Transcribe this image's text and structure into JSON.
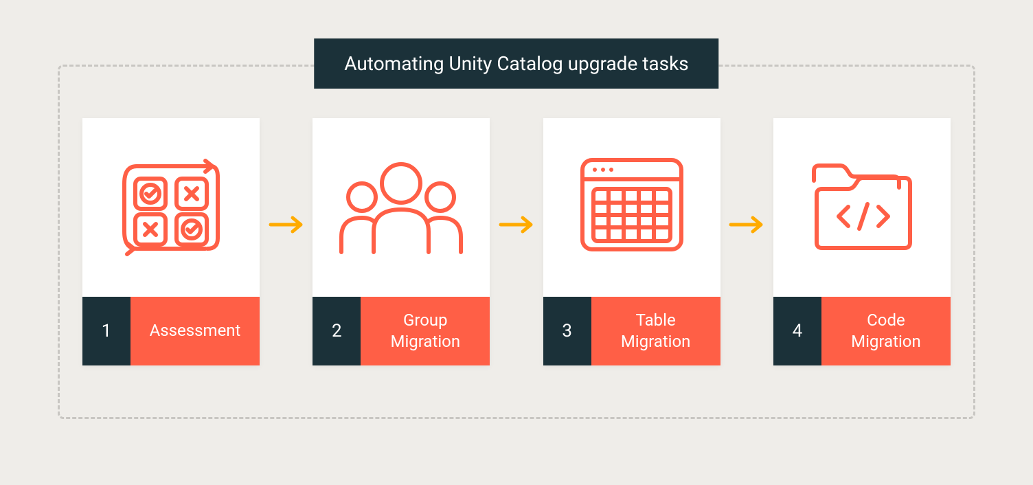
{
  "title": "Automating Unity Catalog upgrade tasks",
  "steps": [
    {
      "num": "1",
      "label": "Assessment",
      "icon": "assessment-icon"
    },
    {
      "num": "2",
      "label": "Group\nMigration",
      "icon": "group-icon"
    },
    {
      "num": "3",
      "label": "Table\nMigration",
      "icon": "table-icon"
    },
    {
      "num": "4",
      "label": "Code\nMigration",
      "icon": "code-icon"
    }
  ],
  "colors": {
    "accent": "#FF5F46",
    "dark": "#1B3139",
    "bg": "#EFEDE9",
    "arrow": "#FFAB00"
  }
}
